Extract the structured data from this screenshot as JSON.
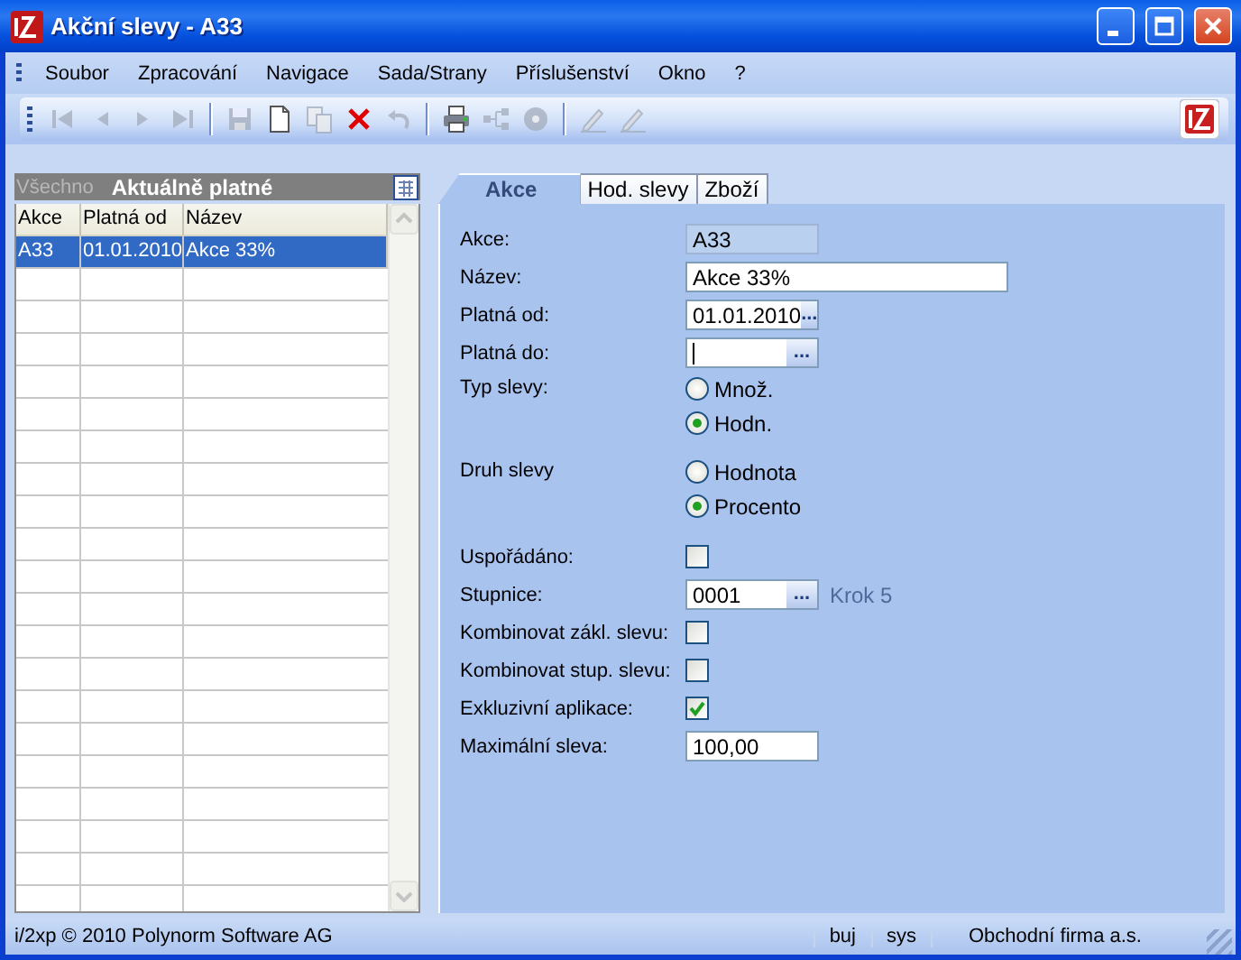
{
  "window": {
    "title": "Akční slevy - A33"
  },
  "menu": [
    "Soubor",
    "Zpracování",
    "Navigace",
    "Sada/Strany",
    "Příslušenství",
    "Okno",
    "?"
  ],
  "toolbar": [
    {
      "kind": "first",
      "disabled": true
    },
    {
      "kind": "prev",
      "disabled": true
    },
    {
      "kind": "next",
      "disabled": true
    },
    {
      "kind": "last",
      "disabled": true
    },
    {
      "kind": "sep"
    },
    {
      "kind": "save",
      "disabled": true
    },
    {
      "kind": "new",
      "disabled": false
    },
    {
      "kind": "copy",
      "disabled": true
    },
    {
      "kind": "delete",
      "disabled": false
    },
    {
      "kind": "undo",
      "disabled": true
    },
    {
      "kind": "sep"
    },
    {
      "kind": "print",
      "disabled": false
    },
    {
      "kind": "tree",
      "disabled": true
    },
    {
      "kind": "disc",
      "disabled": true
    },
    {
      "kind": "sep"
    },
    {
      "kind": "pen",
      "disabled": true
    },
    {
      "kind": "pen",
      "disabled": true
    }
  ],
  "filter": [
    {
      "label": "Všechno",
      "selected": false
    },
    {
      "label": "Aktuálně platné",
      "selected": true
    }
  ],
  "grid": {
    "columns": [
      "Akce",
      "Platná od",
      "Název"
    ],
    "rows": [
      {
        "cells": [
          "A33",
          "01.01.2010",
          "Akce 33%"
        ],
        "selected": true
      }
    ]
  },
  "tabs": [
    {
      "label": "Akce",
      "selected": true
    },
    {
      "label": "Hod. slevy",
      "selected": false
    },
    {
      "label": "Zboží",
      "selected": false
    }
  ],
  "form": [
    {
      "kind": "readonly",
      "label": "Akce:",
      "value": "A33"
    },
    {
      "kind": "text",
      "label": "Název:",
      "value": "Akce 33%"
    },
    {
      "kind": "date",
      "label": "Platná od:",
      "value": "01.01.2010",
      "button": "..."
    },
    {
      "kind": "date",
      "label": "Platná do:",
      "button": "...",
      "focused": true
    },
    {
      "kind": "radio",
      "label": "Typ slevy:",
      "options": [
        {
          "label": "Množ.",
          "selected": false
        },
        {
          "label": "Hodn.",
          "selected": true
        }
      ]
    },
    {
      "kind": "radio",
      "label": "Druh slevy",
      "options": [
        {
          "label": "Hodnota",
          "selected": false
        },
        {
          "label": "Procento",
          "selected": true
        }
      ]
    },
    {
      "kind": "checkbox",
      "label": "Uspořádáno:",
      "checked": false
    },
    {
      "kind": "lookup",
      "label": "Stupnice:",
      "value": "0001",
      "button": "...",
      "note": "Krok 5"
    },
    {
      "kind": "checkbox",
      "label": "Kombinovat zákl. slevu:",
      "checked": false
    },
    {
      "kind": "checkbox",
      "label": "Kombinovat stup. slevu:",
      "checked": false
    },
    {
      "kind": "checkbox",
      "label": "Exkluzivní aplikace:",
      "checked": true
    },
    {
      "kind": "number",
      "label": "Maximální sleva:",
      "value": "100,00"
    }
  ],
  "status_bar": {
    "copyright": "i/2xp © 2010 Polynorm Software AG",
    "user": "buj",
    "database": "sys",
    "company": "Obchodní firma a.s."
  }
}
